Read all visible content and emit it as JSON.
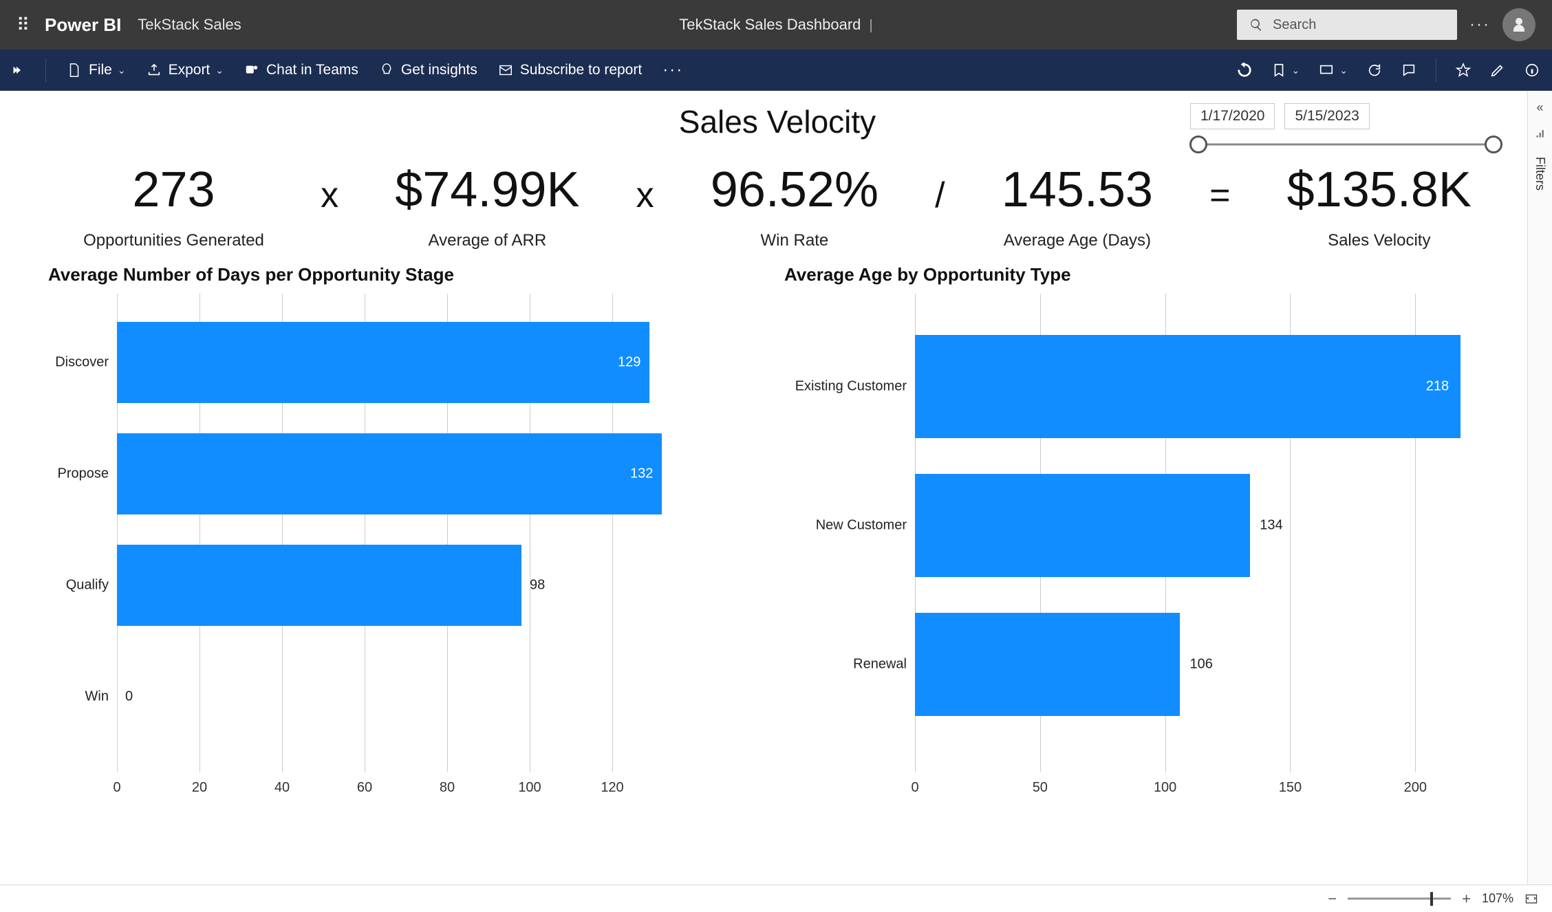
{
  "header": {
    "app_name": "Power BI",
    "workspace": "TekStack Sales",
    "report_title": "TekStack Sales Dashboard",
    "search_placeholder": "Search"
  },
  "ribbon": {
    "file": "File",
    "export": "Export",
    "chat": "Chat in Teams",
    "insights": "Get insights",
    "subscribe": "Subscribe to report"
  },
  "filters_label": "Filters",
  "page": {
    "title": "Sales Velocity",
    "date_from": "1/17/2020",
    "date_to": "5/15/2023"
  },
  "kpi_row": {
    "opps": {
      "value": "273",
      "label": "Opportunities Generated"
    },
    "op1": "x",
    "arr": {
      "value": "$74.99K",
      "label": "Average of ARR"
    },
    "op2": "x",
    "winrate": {
      "value": "96.52%",
      "label": "Win Rate"
    },
    "op3": "/",
    "age": {
      "value": "145.53",
      "label": "Average Age (Days)"
    },
    "op4": "=",
    "velocity": {
      "value": "$135.8K",
      "label": "Sales Velocity"
    }
  },
  "charts": {
    "stage": {
      "title": "Average Number of Days per Opportunity Stage"
    },
    "type": {
      "title": "Average Age by Opportunity Type"
    }
  },
  "statusbar": {
    "zoom": "107%"
  },
  "chart_data": [
    {
      "type": "bar",
      "orientation": "horizontal",
      "title": "Average Number of Days per Opportunity Stage",
      "xlabel": "",
      "ylabel": "",
      "xlim": [
        0,
        140
      ],
      "x_ticks": [
        0,
        20,
        40,
        60,
        80,
        100,
        120
      ],
      "categories": [
        "Discover",
        "Propose",
        "Qualify",
        "Win"
      ],
      "values": [
        129,
        132,
        98,
        0
      ]
    },
    {
      "type": "bar",
      "orientation": "horizontal",
      "title": "Average Age by Opportunity Type",
      "xlabel": "",
      "ylabel": "",
      "xlim": [
        0,
        220
      ],
      "x_ticks": [
        0,
        50,
        100,
        150,
        200
      ],
      "categories": [
        "Existing Customer",
        "New Customer",
        "Renewal"
      ],
      "values": [
        218,
        134,
        106
      ]
    }
  ]
}
